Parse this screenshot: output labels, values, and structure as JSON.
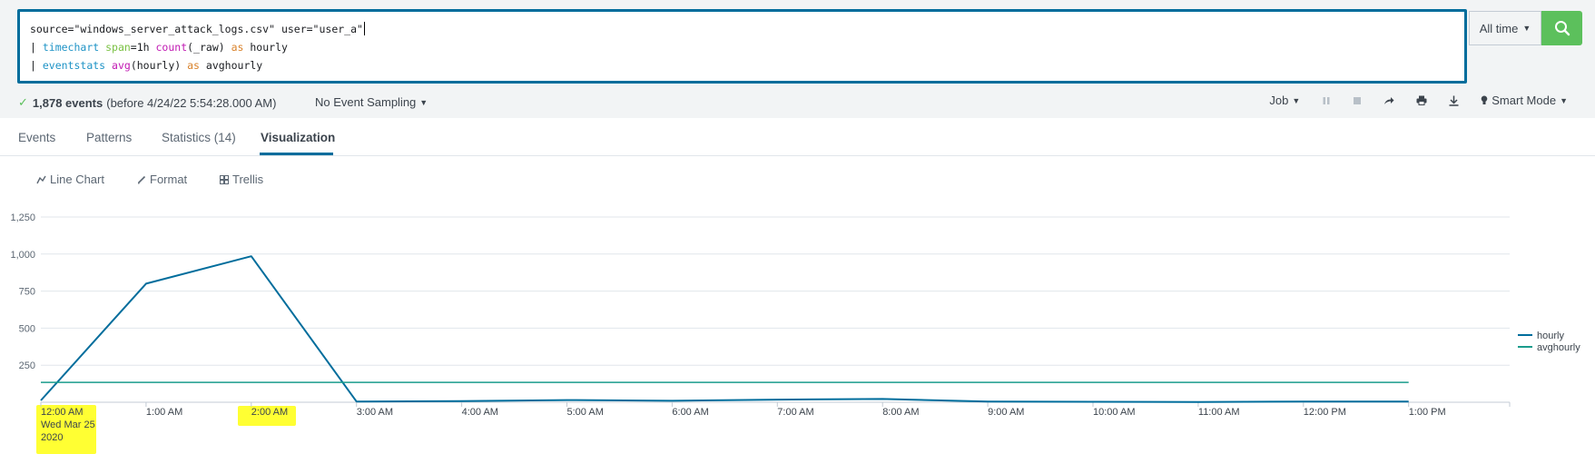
{
  "search": {
    "line1_text": "source=\"windows_server_attack_logs.csv\" user=\"user_a\"",
    "line2": {
      "pipe": "| ",
      "cmd": "timechart",
      "arg1": " span",
      "arg1_val": "=1h ",
      "fn": "count",
      "fn_args": "(_raw) ",
      "as": "as",
      "alias": " hourly"
    },
    "line3": {
      "pipe": "| ",
      "cmd": "eventstats",
      "fn": " avg",
      "fn_args": "(hourly) ",
      "as": "as",
      "alias": " avghourly"
    }
  },
  "time_picker": {
    "label": "All time"
  },
  "status": {
    "event_count": "1,878 events",
    "before": "(before 4/24/22 5:54:28.000 AM)",
    "sampling": "No Event Sampling",
    "job": "Job",
    "mode": "Smart Mode"
  },
  "tabs": [
    {
      "label": "Events"
    },
    {
      "label": "Patterns"
    },
    {
      "label": "Statistics (14)"
    },
    {
      "label": "Visualization"
    }
  ],
  "viz_toolbar": {
    "chart_type": "Line Chart",
    "format": "Format",
    "trellis": "Trellis"
  },
  "colors": {
    "accent": "#006d9c",
    "search_green": "#5cc05c",
    "series_hourly": "#006d9c",
    "series_avg": "#1a9c8c",
    "highlight": "#ffff33"
  },
  "chart_data": {
    "type": "line",
    "x": [
      "12:00 AM\nWed Mar 25\n2020",
      "1:00 AM",
      "2:00 AM",
      "3:00 AM",
      "4:00 AM",
      "5:00 AM",
      "6:00 AM",
      "7:00 AM",
      "8:00 AM",
      "9:00 AM",
      "10:00 AM",
      "11:00 AM",
      "12:00 PM",
      "1:00 PM"
    ],
    "series": [
      {
        "name": "hourly",
        "values": [
          12,
          800,
          985,
          5,
          8,
          15,
          10,
          18,
          22,
          5,
          3,
          2,
          4,
          5
        ]
      },
      {
        "name": "avghourly",
        "values": [
          134,
          134,
          134,
          134,
          134,
          134,
          134,
          134,
          134,
          134,
          134,
          134,
          134,
          134
        ]
      }
    ],
    "yticks": [
      "1,250",
      "1,000",
      "750",
      "500",
      "250"
    ],
    "ylim": [
      0,
      1250
    ],
    "legend": "right",
    "grid": true
  }
}
